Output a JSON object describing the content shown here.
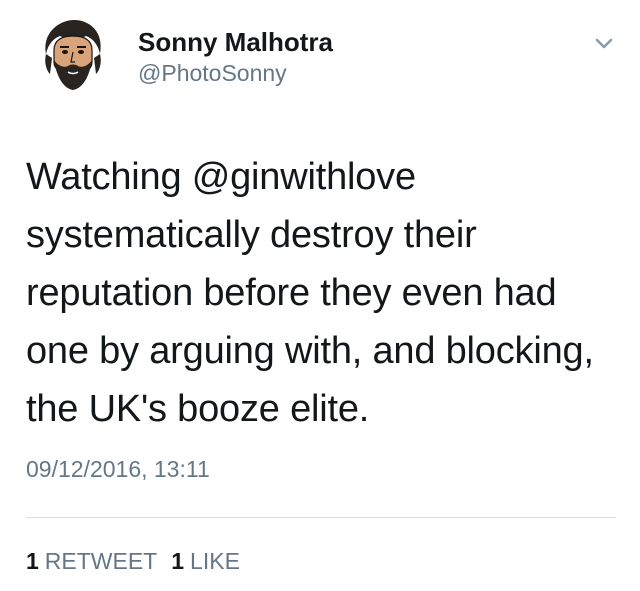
{
  "author": {
    "display_name": "Sonny Malhotra",
    "handle": "@PhotoSonny",
    "avatar_icon": "bearded-man-avatar"
  },
  "menu": {
    "icon": "chevron-down-icon"
  },
  "tweet": {
    "text_lines": [
      "Watching @ginwithlove",
      "systematically destroy their",
      "reputation before they even had",
      "one by arguing with, and blocking,",
      "the UK's booze elite."
    ],
    "timestamp": "09/12/2016, 13:11"
  },
  "stats": {
    "retweets_count": "1",
    "retweets_label": "RETWEET",
    "likes_count": "1",
    "likes_label": "LIKE"
  },
  "colors": {
    "text_primary": "#14171a",
    "text_secondary": "#657786",
    "divider": "#d8dde2"
  }
}
